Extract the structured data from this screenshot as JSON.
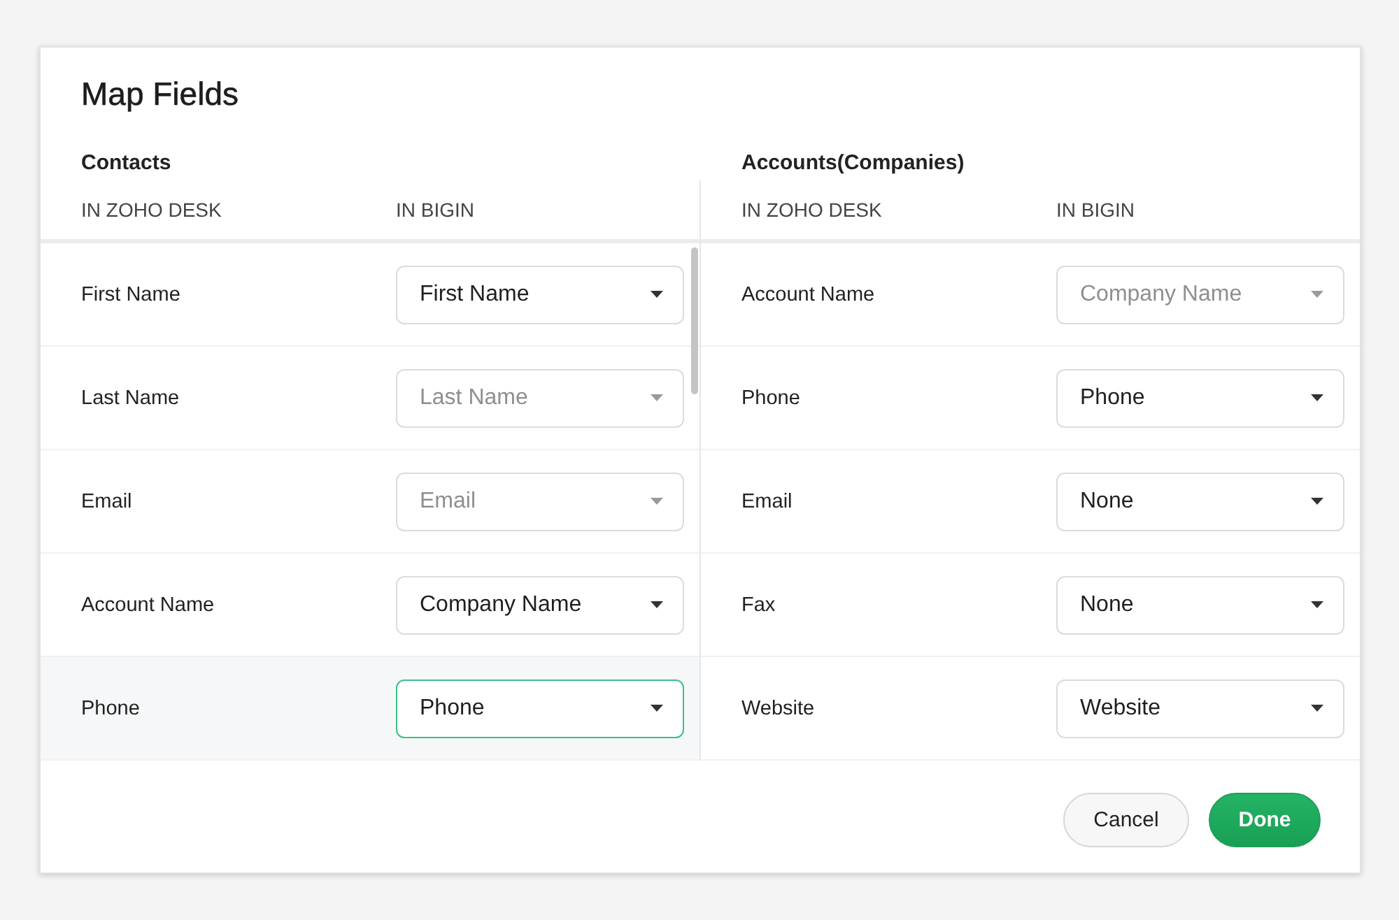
{
  "dialog": {
    "title": "Map Fields"
  },
  "sections": [
    {
      "title": "Contacts",
      "columns": [
        "IN ZOHO DESK",
        "IN BIGIN"
      ],
      "rows": [
        {
          "label": "First Name",
          "value": "First Name",
          "disabled": false,
          "focused": false
        },
        {
          "label": "Last Name",
          "value": "Last Name",
          "disabled": true,
          "focused": false
        },
        {
          "label": "Email",
          "value": "Email",
          "disabled": true,
          "focused": false
        },
        {
          "label": "Account Name",
          "value": "Company Name",
          "disabled": false,
          "focused": false
        },
        {
          "label": "Phone",
          "value": "Phone",
          "disabled": false,
          "focused": true
        }
      ]
    },
    {
      "title": "Accounts(Companies)",
      "columns": [
        "IN ZOHO DESK",
        "IN BIGIN"
      ],
      "rows": [
        {
          "label": "Account Name",
          "value": "Company Name",
          "disabled": true,
          "focused": false
        },
        {
          "label": "Phone",
          "value": "Phone",
          "disabled": false,
          "focused": false
        },
        {
          "label": "Email",
          "value": "None",
          "disabled": false,
          "focused": false
        },
        {
          "label": "Fax",
          "value": "None",
          "disabled": false,
          "focused": false
        },
        {
          "label": "Website",
          "value": "Website",
          "disabled": false,
          "focused": false
        }
      ]
    }
  ],
  "buttons": [
    {
      "label": "Cancel",
      "kind": "secondary"
    },
    {
      "label": "Done",
      "kind": "primary"
    }
  ]
}
